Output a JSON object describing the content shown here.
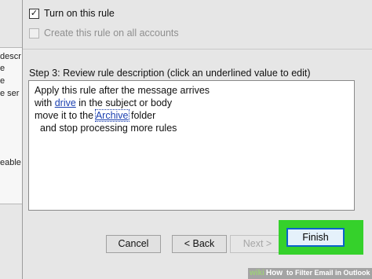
{
  "background_window": {
    "lines": [
      "descr",
      "e",
      "e",
      "e ser",
      "eable"
    ]
  },
  "rule_options": {
    "turn_on": {
      "label": "Turn on this rule",
      "checked": true
    },
    "all_accounts": {
      "label": "Create this rule on all accounts",
      "checked": false,
      "disabled": true
    }
  },
  "step3": {
    "title": "Step 3: Review rule description (click an underlined value to edit)",
    "line1": "Apply this rule after the message arrives",
    "line2_prefix": "with ",
    "line2_link": "drive",
    "line2_suffix": " in the subject or body",
    "line3_prefix": "move it to the ",
    "line3_link": "Archive",
    "line3_suffix": " folder",
    "line4": "and stop processing more rules"
  },
  "buttons": {
    "cancel": "Cancel",
    "back": "< Back",
    "next": "Next >",
    "finish": "Finish"
  },
  "watermark": {
    "logo_a": "wiki",
    "logo_b": "How",
    "text": "to Filter Email in Outlook"
  },
  "colors": {
    "link": "#1a3fb0",
    "highlight": "#35d12b",
    "finish_border": "#0a63c9",
    "dialog_bg": "#e6e6e6"
  }
}
